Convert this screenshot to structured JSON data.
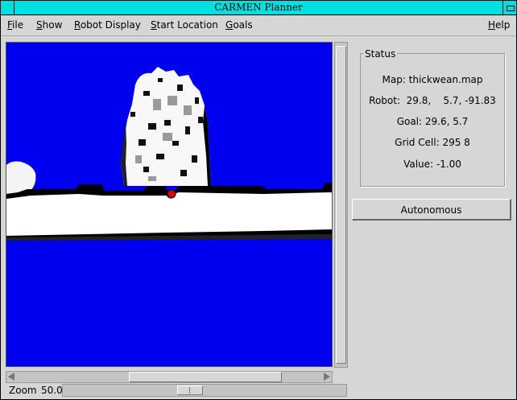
{
  "window": {
    "title": "CARMEN Planner"
  },
  "menu": {
    "file": {
      "underline": "F",
      "rest": "ile"
    },
    "show": {
      "underline": "S",
      "rest": "how"
    },
    "robot_display": {
      "underline": "R",
      "rest": "obot Display"
    },
    "start_location": {
      "underline": "S",
      "rest": "tart Location"
    },
    "goals": {
      "underline": "G",
      "rest": "oals"
    },
    "help": {
      "underline": "H",
      "rest": "elp"
    }
  },
  "status": {
    "legend": "Status",
    "map": "Map: thickwean.map",
    "robot": "Robot:  29.8,    5.7, -91.83",
    "goal": "Goal: 29.6, 5.7",
    "grid_cell": "Grid Cell: 295 8",
    "value": "Value: -1.00"
  },
  "autonomous_button": "Autonomous",
  "zoom": {
    "label": "Zoom",
    "value": "50.0"
  },
  "colors": {
    "unknown": "#0000f0",
    "free": "#ffffff",
    "occupied": "#000000",
    "robot": "#e00000",
    "title_bar": "#00e0e0"
  }
}
